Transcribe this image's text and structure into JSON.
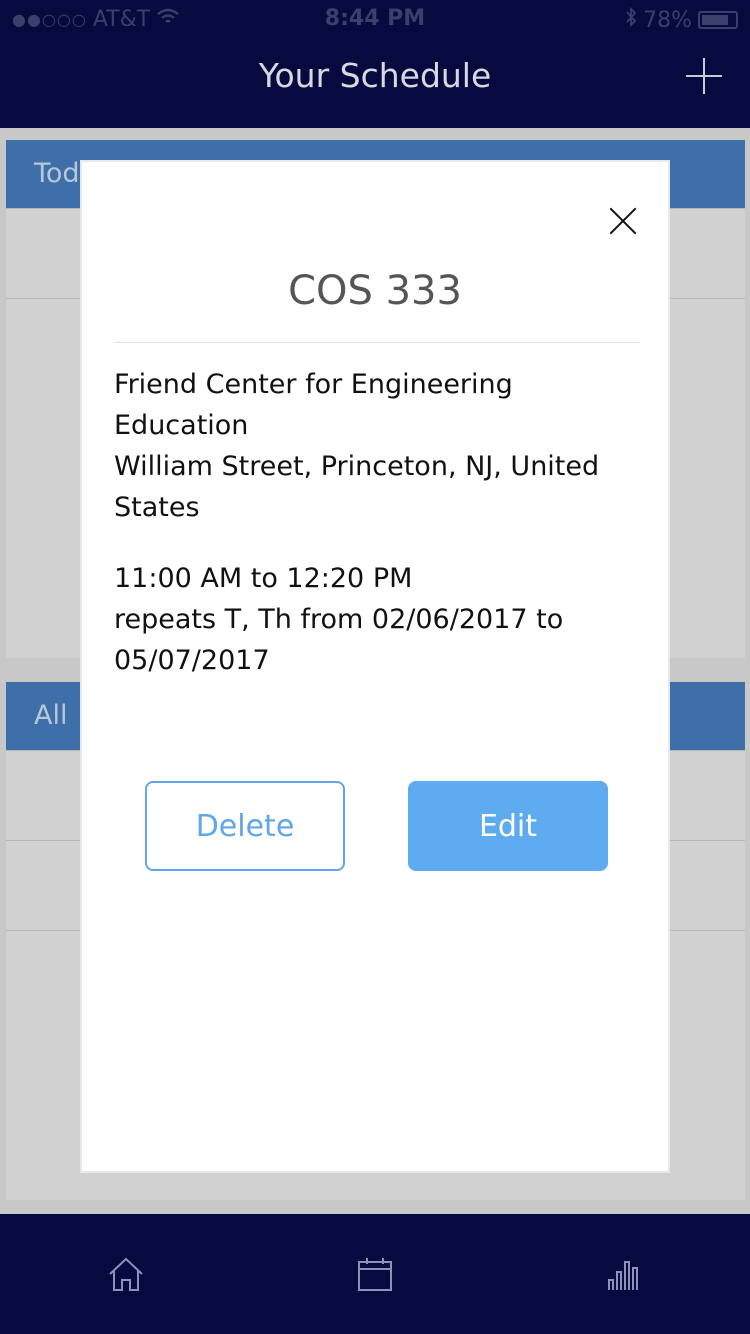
{
  "status_bar": {
    "signal_dots": "●●○○○",
    "carrier": "AT&T",
    "time": "8:44 PM",
    "battery": "78%"
  },
  "nav": {
    "title": "Your Schedule",
    "add_icon": "plus-icon"
  },
  "background_cards": [
    {
      "header_fragment": "Tod"
    },
    {
      "header_fragment": "All"
    }
  ],
  "modal": {
    "title": "COS 333",
    "location_line1": "Friend Center for Engineering Education",
    "location_line2": "William Street, Princeton, NJ, United States",
    "time_range": "11:00 AM to 12:20 PM",
    "repeats": "repeats T, Th from 02/06/2017 to 05/07/2017",
    "delete_label": "Delete",
    "edit_label": "Edit",
    "close_icon": "close-icon"
  },
  "tabbar": {
    "items": [
      "home-icon",
      "calendar-icon",
      "stats-icon"
    ]
  },
  "colors": {
    "nav_bg": "#070a3f",
    "card_header": "#3f6fa8",
    "accent": "#5eacef"
  }
}
